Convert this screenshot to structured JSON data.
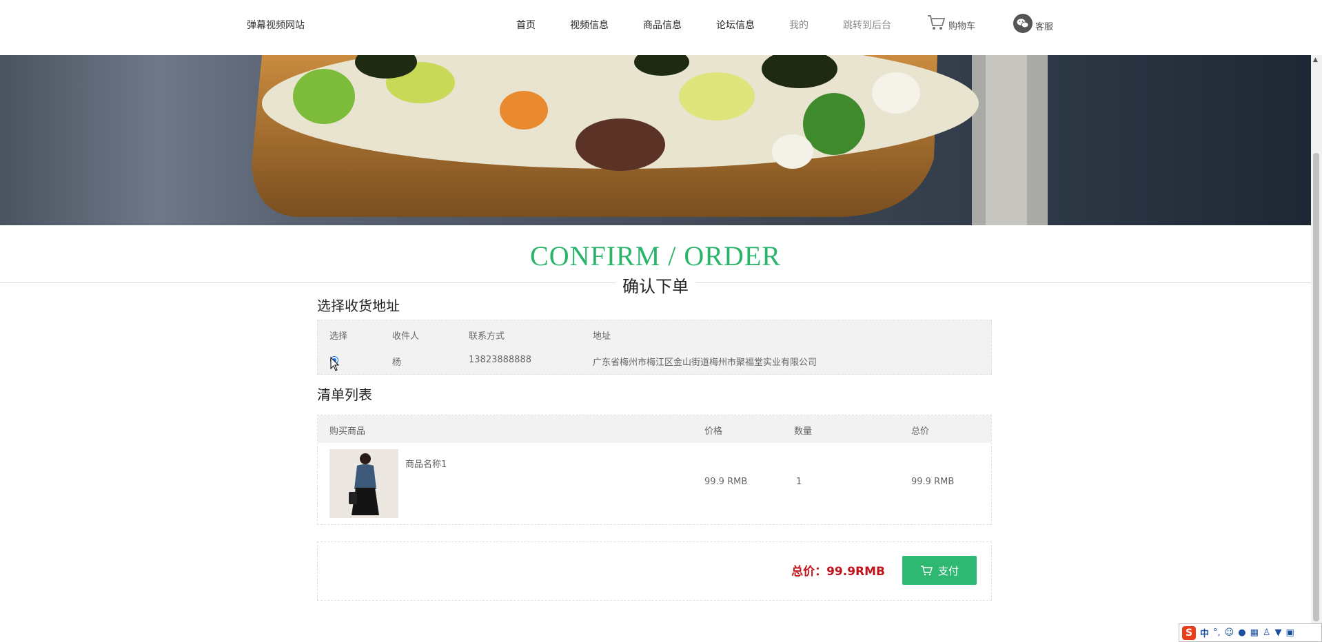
{
  "header": {
    "site_title": "弹幕视频网站",
    "nav": [
      {
        "label": "首页"
      },
      {
        "label": "视频信息"
      },
      {
        "label": "商品信息"
      },
      {
        "label": "论坛信息"
      },
      {
        "label": "我的"
      },
      {
        "label": "跳转到后台"
      }
    ],
    "cart_label": "购物车",
    "service_label": "客服"
  },
  "page": {
    "heading_en": "CONFIRM / ORDER",
    "heading_cn": "确认下单"
  },
  "address": {
    "section_title": "选择收货地址",
    "columns": [
      "选择",
      "收件人",
      "联系方式",
      "地址"
    ],
    "rows": [
      {
        "selected": true,
        "recipient": "杨",
        "phone": "13823888888",
        "address": "广东省梅州市梅江区金山街道梅州市聚福堂实业有限公司"
      }
    ]
  },
  "items": {
    "section_title": "清单列表",
    "columns": [
      "购买商品",
      "价格",
      "数量",
      "总价"
    ],
    "rows": [
      {
        "name": "商品名称1",
        "price": "99.9 RMB",
        "quantity": "1",
        "total": "99.9 RMB"
      }
    ]
  },
  "summary": {
    "total_text": "总价：99.9RMB",
    "pay_label": "支付"
  },
  "colors": {
    "accent": "#2eb872",
    "heading": "#29b36b",
    "total": "#c0141c"
  },
  "ime": {
    "mode": "中"
  }
}
